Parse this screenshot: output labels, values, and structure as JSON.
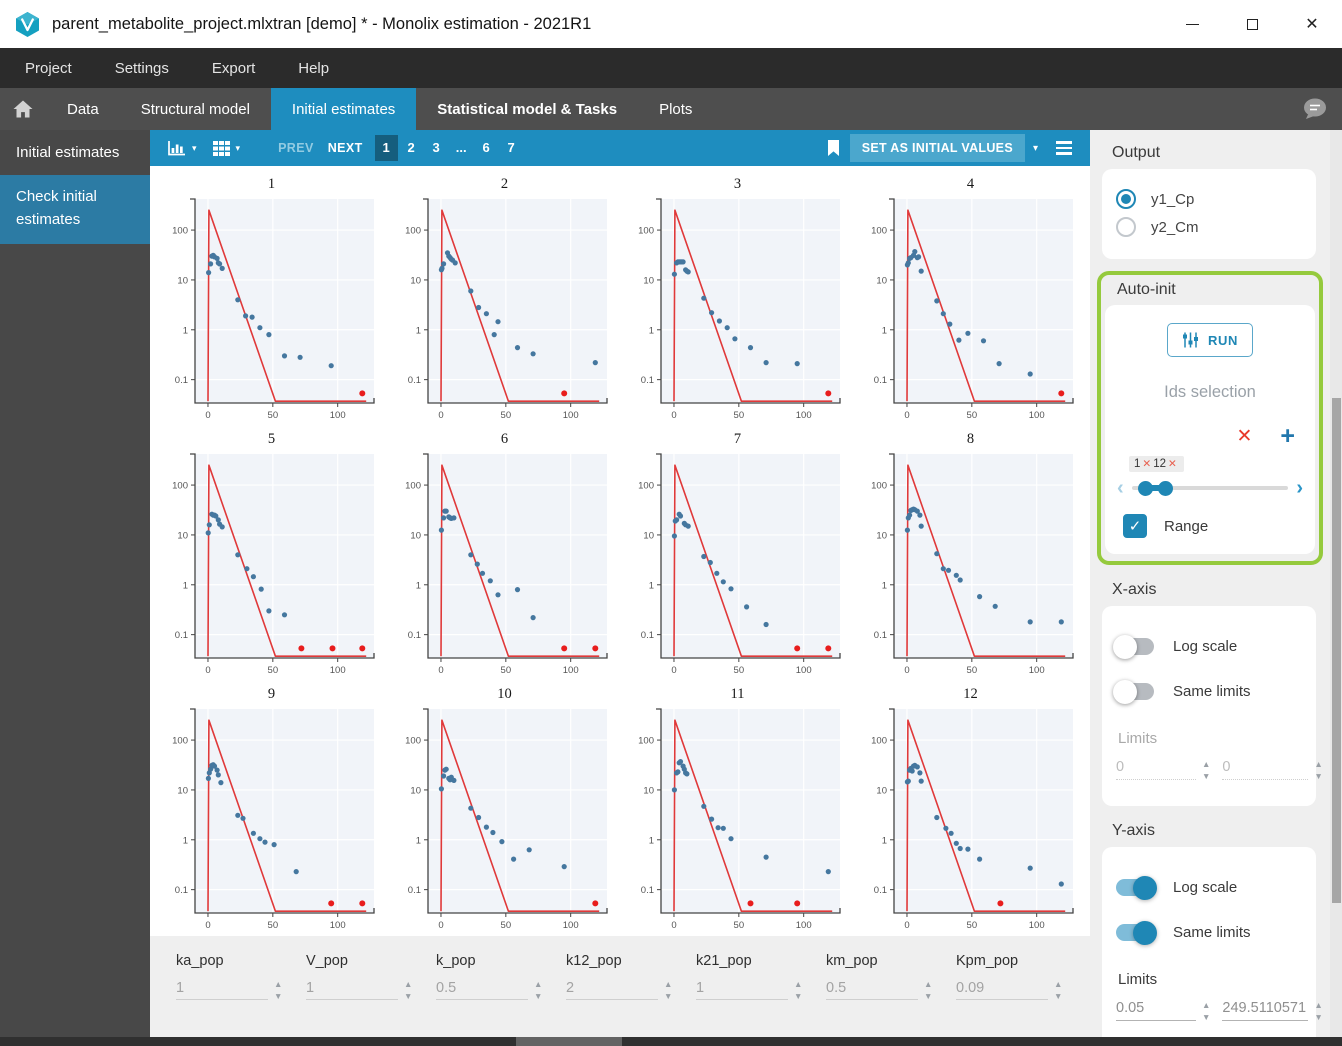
{
  "window": {
    "title": "parent_metabolite_project.mlxtran [demo] * - Monolix estimation - 2021R1"
  },
  "menubar": {
    "items": [
      "Project",
      "Settings",
      "Export",
      "Help"
    ]
  },
  "tabbar": {
    "tabs": [
      {
        "label": "Data",
        "active": false,
        "bold": false
      },
      {
        "label": "Structural model",
        "active": false,
        "bold": false
      },
      {
        "label": "Initial estimates",
        "active": true,
        "bold": false
      },
      {
        "label": "Statistical model & Tasks",
        "active": false,
        "bold": true
      },
      {
        "label": "Plots",
        "active": false,
        "bold": false
      }
    ]
  },
  "sidebar": {
    "header": "Initial estimates",
    "items": [
      {
        "label": "Check initial estimates",
        "active": true
      }
    ]
  },
  "toolbar": {
    "prev": "PREV",
    "next": "NEXT",
    "pages": [
      "1",
      "2",
      "3",
      "...",
      "6",
      "7"
    ],
    "active_page": "1",
    "set_button": "SET AS INITIAL VALUES"
  },
  "icons": {
    "caret": "▾",
    "clear": "✕",
    "add": "+",
    "check": "✓",
    "chevron_left": "‹",
    "chevron_right": "›",
    "up": "▲",
    "down": "▼"
  },
  "parameters": [
    {
      "name": "ka_pop",
      "value": "1"
    },
    {
      "name": "V_pop",
      "value": "1"
    },
    {
      "name": "k_pop",
      "value": "0.5"
    },
    {
      "name": "k12_pop",
      "value": "2"
    },
    {
      "name": "k21_pop",
      "value": "1"
    },
    {
      "name": "km_pop",
      "value": "0.5"
    },
    {
      "name": "Kpm_pop",
      "value": "0.09"
    }
  ],
  "panel": {
    "output": {
      "title": "Output",
      "options": [
        {
          "label": "y1_Cp",
          "selected": true
        },
        {
          "label": "y2_Cm",
          "selected": false
        }
      ]
    },
    "autoinit": {
      "title": "Auto-init",
      "run_label": "RUN",
      "ids_placeholder": "Ids selection",
      "selected_ids": [
        "1",
        "12"
      ],
      "range_label": "Range",
      "range_checked": true
    },
    "xaxis": {
      "title": "X-axis",
      "log_label": "Log scale",
      "log_on": false,
      "same_label": "Same limits",
      "same_on": false,
      "limits_label": "Limits",
      "min": "0",
      "max": "0",
      "enabled": false
    },
    "yaxis": {
      "title": "Y-axis",
      "log_label": "Log scale",
      "log_on": true,
      "same_label": "Same limits",
      "same_on": true,
      "limits_label": "Limits",
      "min": "0.05",
      "max": "249.5110571",
      "enabled": true
    }
  },
  "colors": {
    "accent_blue": "#1e8dbf",
    "active_page_blue": "#155e7e",
    "set_button_blue": "#4ba7cd",
    "sidebar_selected": "#2c7ba4",
    "highlight_green": "#95ca3d",
    "toggle_on": "#1f87b5",
    "line_red": "#e0393a",
    "point_blue": "#45779f",
    "censored_red": "#e81d1d"
  },
  "chart_data": {
    "type": "scatter",
    "y_scale": "log",
    "x_ticks": [
      0,
      50,
      100
    ],
    "y_ticks": [
      100,
      10,
      1,
      0.1
    ],
    "x_range": [
      -10,
      128
    ],
    "y_range": [
      0.034,
      420
    ],
    "grid": {
      "rows": 3,
      "cols": 4
    },
    "prediction_line": [
      [
        0,
        0.037
      ],
      [
        0.7,
        250
      ],
      [
        52,
        0.037
      ],
      [
        122,
        0.037
      ]
    ],
    "subplots": [
      {
        "title": "1",
        "points": [
          [
            0.5,
            14
          ],
          [
            2,
            21
          ],
          [
            3,
            30
          ],
          [
            4,
            31
          ],
          [
            5,
            29
          ],
          [
            7,
            27
          ],
          [
            8,
            22
          ],
          [
            9,
            21
          ],
          [
            11,
            17
          ],
          [
            23,
            4
          ],
          [
            29,
            1.9
          ],
          [
            34,
            1.8
          ],
          [
            40,
            1.1
          ],
          [
            47,
            0.8
          ],
          [
            59,
            0.3
          ],
          [
            71,
            0.28
          ],
          [
            95,
            0.19
          ]
        ],
        "censored": [
          [
            119,
            0.053
          ]
        ]
      },
      {
        "title": "2",
        "points": [
          [
            0.3,
            16
          ],
          [
            0.8,
            17
          ],
          [
            2,
            21
          ],
          [
            5,
            35
          ],
          [
            6,
            30
          ],
          [
            7,
            28
          ],
          [
            8,
            26
          ],
          [
            9,
            25
          ],
          [
            11,
            22
          ],
          [
            23,
            6
          ],
          [
            29,
            2.8
          ],
          [
            35,
            2.1
          ],
          [
            41,
            0.8
          ],
          [
            44,
            1.45
          ],
          [
            59,
            0.44
          ],
          [
            71,
            0.33
          ],
          [
            119,
            0.22
          ]
        ],
        "censored": [
          [
            95,
            0.053
          ]
        ]
      },
      {
        "title": "3",
        "points": [
          [
            0.3,
            13
          ],
          [
            2,
            22
          ],
          [
            3,
            23
          ],
          [
            4,
            23
          ],
          [
            5,
            23
          ],
          [
            6,
            23
          ],
          [
            7,
            23
          ],
          [
            9,
            16
          ],
          [
            10,
            15
          ],
          [
            11,
            14.5
          ],
          [
            23,
            4.3
          ],
          [
            29,
            2.2
          ],
          [
            35,
            1.5
          ],
          [
            41,
            1.1
          ],
          [
            47,
            0.66
          ],
          [
            59,
            0.44
          ],
          [
            71,
            0.22
          ],
          [
            95,
            0.21
          ]
        ],
        "censored": [
          [
            119,
            0.053
          ]
        ]
      },
      {
        "title": "4",
        "points": [
          [
            0.3,
            20
          ],
          [
            1,
            22
          ],
          [
            2,
            27
          ],
          [
            3,
            28
          ],
          [
            5,
            31
          ],
          [
            6,
            37
          ],
          [
            8,
            28
          ],
          [
            9,
            29
          ],
          [
            11,
            15
          ],
          [
            23,
            3.8
          ],
          [
            28,
            2.1
          ],
          [
            33,
            1.3
          ],
          [
            40,
            0.62
          ],
          [
            47,
            0.85
          ],
          [
            59,
            0.6
          ],
          [
            71,
            0.21
          ],
          [
            95,
            0.13
          ]
        ],
        "censored": [
          [
            119,
            0.053
          ]
        ]
      },
      {
        "title": "5",
        "points": [
          [
            0.2,
            11
          ],
          [
            1,
            16
          ],
          [
            3,
            26
          ],
          [
            4,
            25
          ],
          [
            5,
            25
          ],
          [
            6,
            24
          ],
          [
            8,
            20
          ],
          [
            9,
            16.5
          ],
          [
            11,
            14.5
          ],
          [
            23,
            4
          ],
          [
            30,
            2.1
          ],
          [
            35,
            1.45
          ],
          [
            41,
            0.82
          ],
          [
            47,
            0.3
          ],
          [
            59,
            0.25
          ]
        ],
        "censored": [
          [
            72,
            0.053
          ],
          [
            96,
            0.053
          ],
          [
            119,
            0.053
          ]
        ]
      },
      {
        "title": "6",
        "points": [
          [
            0.3,
            12.5
          ],
          [
            2,
            22
          ],
          [
            3,
            30
          ],
          [
            4,
            30
          ],
          [
            6,
            23
          ],
          [
            7,
            22
          ],
          [
            8,
            21.5
          ],
          [
            10,
            22
          ],
          [
            23,
            4
          ],
          [
            28,
            2.6
          ],
          [
            32,
            1.7
          ],
          [
            38,
            1.2
          ],
          [
            44,
            0.63
          ],
          [
            59,
            0.8
          ],
          [
            71,
            0.22
          ]
        ],
        "censored": [
          [
            95,
            0.053
          ],
          [
            119,
            0.053
          ]
        ]
      },
      {
        "title": "7",
        "points": [
          [
            0.3,
            9.5
          ],
          [
            1,
            19
          ],
          [
            2,
            20
          ],
          [
            4,
            26
          ],
          [
            5,
            24
          ],
          [
            8,
            17
          ],
          [
            9,
            16
          ],
          [
            11,
            15
          ],
          [
            23,
            3.7
          ],
          [
            28,
            2.8
          ],
          [
            33,
            1.7
          ],
          [
            38,
            1.15
          ],
          [
            44,
            0.83
          ],
          [
            56,
            0.36
          ],
          [
            71,
            0.16
          ]
        ],
        "censored": [
          [
            95,
            0.053
          ],
          [
            119,
            0.053
          ]
        ]
      },
      {
        "title": "8",
        "points": [
          [
            0.3,
            12.5
          ],
          [
            1,
            22
          ],
          [
            2,
            25
          ],
          [
            3,
            31
          ],
          [
            4,
            32
          ],
          [
            5,
            33
          ],
          [
            6,
            32
          ],
          [
            8,
            30
          ],
          [
            10,
            25
          ],
          [
            11,
            15
          ],
          [
            23,
            4.2
          ],
          [
            28,
            2.1
          ],
          [
            32,
            1.95
          ],
          [
            38,
            1.55
          ],
          [
            41,
            1.25
          ],
          [
            56,
            0.58
          ],
          [
            68,
            0.37
          ],
          [
            95,
            0.18
          ],
          [
            119,
            0.18
          ]
        ],
        "censored": []
      },
      {
        "title": "9",
        "points": [
          [
            0.3,
            17
          ],
          [
            1,
            22
          ],
          [
            2,
            26
          ],
          [
            3,
            31
          ],
          [
            4,
            32
          ],
          [
            5,
            30
          ],
          [
            7,
            25
          ],
          [
            8,
            20
          ],
          [
            10,
            14
          ],
          [
            23,
            3.1
          ],
          [
            27,
            2.7
          ],
          [
            35,
            1.35
          ],
          [
            40,
            1.05
          ],
          [
            44,
            0.9
          ],
          [
            51,
            0.8
          ],
          [
            68,
            0.23
          ]
        ],
        "censored": [
          [
            95,
            0.053
          ],
          [
            119,
            0.053
          ]
        ]
      },
      {
        "title": "10",
        "points": [
          [
            0.3,
            10.5
          ],
          [
            2,
            19
          ],
          [
            3,
            25
          ],
          [
            4,
            26
          ],
          [
            6,
            17
          ],
          [
            7,
            16
          ],
          [
            8,
            18
          ],
          [
            10,
            15.5
          ],
          [
            23,
            4.3
          ],
          [
            29,
            2.8
          ],
          [
            35,
            1.8
          ],
          [
            40,
            1.4
          ],
          [
            47,
            0.92
          ],
          [
            56,
            0.41
          ],
          [
            68,
            0.63
          ],
          [
            95,
            0.29
          ]
        ],
        "censored": [
          [
            119,
            0.053
          ]
        ]
      },
      {
        "title": "11",
        "points": [
          [
            0.3,
            10
          ],
          [
            2,
            22
          ],
          [
            3,
            23
          ],
          [
            4,
            35
          ],
          [
            5,
            37
          ],
          [
            7,
            30
          ],
          [
            8,
            26
          ],
          [
            9,
            22
          ],
          [
            10,
            21
          ],
          [
            23,
            4.7
          ],
          [
            29,
            2.6
          ],
          [
            34,
            1.75
          ],
          [
            38,
            1.7
          ],
          [
            44,
            1.05
          ],
          [
            71,
            0.45
          ],
          [
            119,
            0.23
          ]
        ],
        "censored": [
          [
            59,
            0.053
          ],
          [
            95,
            0.053
          ]
        ]
      },
      {
        "title": "12",
        "points": [
          [
            0.3,
            14.5
          ],
          [
            1,
            15
          ],
          [
            2,
            25
          ],
          [
            3,
            27
          ],
          [
            4,
            24
          ],
          [
            5,
            30
          ],
          [
            6,
            31
          ],
          [
            8,
            29
          ],
          [
            10,
            22
          ],
          [
            11,
            15
          ],
          [
            23,
            2.8
          ],
          [
            30,
            1.7
          ],
          [
            34,
            1.35
          ],
          [
            38,
            0.85
          ],
          [
            41,
            0.67
          ],
          [
            47,
            0.65
          ],
          [
            56,
            0.41
          ],
          [
            95,
            0.27
          ],
          [
            119,
            0.13
          ]
        ],
        "censored": [
          [
            72,
            0.053
          ]
        ]
      }
    ]
  }
}
